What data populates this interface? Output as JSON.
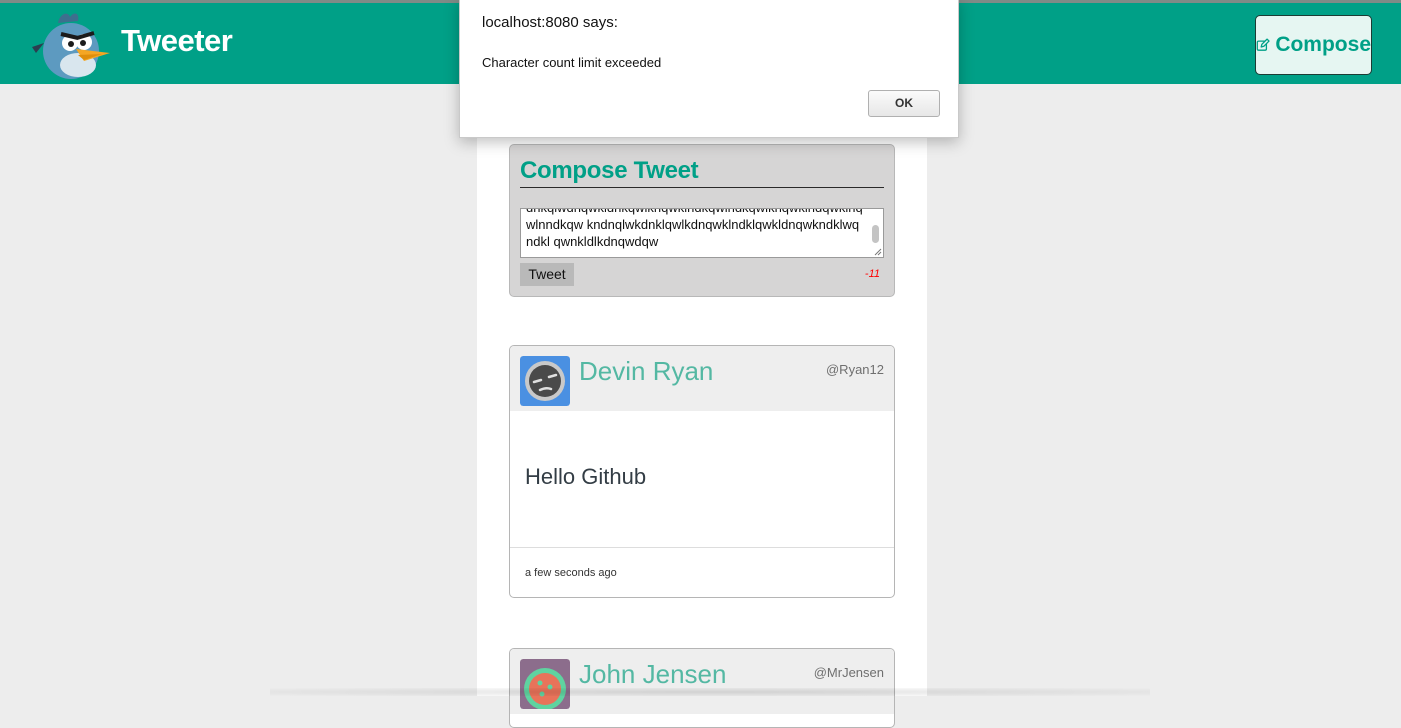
{
  "header": {
    "brand": "Tweeter",
    "logo_icon": "blue-bird-logo",
    "compose_label": "Compose",
    "compose_icon": "edit-icon",
    "accent_color": "#00a087"
  },
  "compose": {
    "title": "Compose Tweet",
    "textarea_value": "dnkqlwdnqwkldnkqwlknqwklndkqwlndkqwlknqwklndqwklnqwlnndkqw kndnqlwkdnklqwlkdnqwklndklqwkldnqwkndklwqndkl qwnkldlkdnqwdqw",
    "tweet_label": "Tweet",
    "char_counter": "-11",
    "counter_color": "#ff0000"
  },
  "tweets": [
    {
      "name": "Devin Ryan",
      "handle": "@Ryan12",
      "content": "Hello Github",
      "timestamp": "a few seconds ago",
      "avatar_icon": "sleepy-face-avatar"
    },
    {
      "name": "John Jensen",
      "handle": "@MrJensen",
      "avatar_icon": "cookie-avatar"
    }
  ],
  "dialog": {
    "title": "localhost:8080 says:",
    "message": "Character count limit exceeded",
    "ok_label": "OK"
  }
}
